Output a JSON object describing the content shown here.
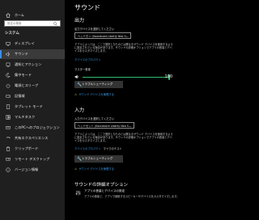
{
  "sidebar": {
    "home_label": "ホーム",
    "search_placeholder": "設定の検索",
    "section_label": "システム",
    "items": [
      {
        "label": "ディスプレイ",
        "icon": "monitor-icon"
      },
      {
        "label": "サウンド",
        "icon": "speaker-icon"
      },
      {
        "label": "通知とアクション",
        "icon": "notification-icon"
      },
      {
        "label": "集中モード",
        "icon": "moon-icon"
      },
      {
        "label": "電源とスリープ",
        "icon": "power-icon"
      },
      {
        "label": "記憶域",
        "icon": "storage-icon"
      },
      {
        "label": "タブレット モード",
        "icon": "tablet-icon"
      },
      {
        "label": "マルチタスク",
        "icon": "multitask-icon"
      },
      {
        "label": "このPCへのプロジェクション",
        "icon": "projection-icon"
      },
      {
        "label": "共有エクスペリエンス",
        "icon": "shared-icon"
      },
      {
        "label": "クリップボード",
        "icon": "clipboard-icon"
      },
      {
        "label": "リモート デスクトップ",
        "icon": "remote-icon"
      },
      {
        "label": "バージョン情報",
        "icon": "info-icon"
      }
    ],
    "active_index": 1
  },
  "main": {
    "title": "サウンド",
    "output": {
      "heading": "出力",
      "select_label": "出力デバイスを選択してください",
      "device": "ヘッドホン (Soundcore Liberty Neo S...",
      "description": "アプリによっては、ここで選択したものとは異なるサウンド デバイスを使用するように設定されている場合があります。サウンドの詳細オプションでアプリの音量とデバイスをカスタマイズします。",
      "properties_link": "デバイスのプロパティ",
      "volume_label": "マスター音量",
      "volume_value": "100",
      "volume_level": 1.0,
      "troubleshoot": "トラブルシューティング",
      "manage_link": "サウンド デバイスを管理する"
    },
    "input": {
      "heading": "入力",
      "select_label": "入力デバイスを選択してください",
      "device": "ヘッドセット (Soundcore Liberty Neo S...",
      "description": "アプリによっては、ここで選択したものとは異なるサウンド デバイスを使用するように設定されている場合があります。サウンドの詳細オプションでアプリの音量とデバイスをカスタマイズします。",
      "properties_link": "デバイスのプロパティ",
      "mic_test_label": "マイクのテスト",
      "troubleshoot": "トラブルシューティング",
      "manage_link": "サウンド デバイスを管理する"
    },
    "advanced": {
      "heading": "サウンドの詳細オプション",
      "app_volume_title": "アプリの音量とデバイスの設定",
      "app_volume_desc": "アプリの音量と、アプリで使用するスピーカーやデバイスをカスタマイズします。"
    }
  },
  "colors": {
    "accent": "#3b8eea",
    "link": "#3b9dea",
    "slider": "#2fc06d",
    "sidebar_bg": "#1f1f1f",
    "bg": "#000000"
  }
}
